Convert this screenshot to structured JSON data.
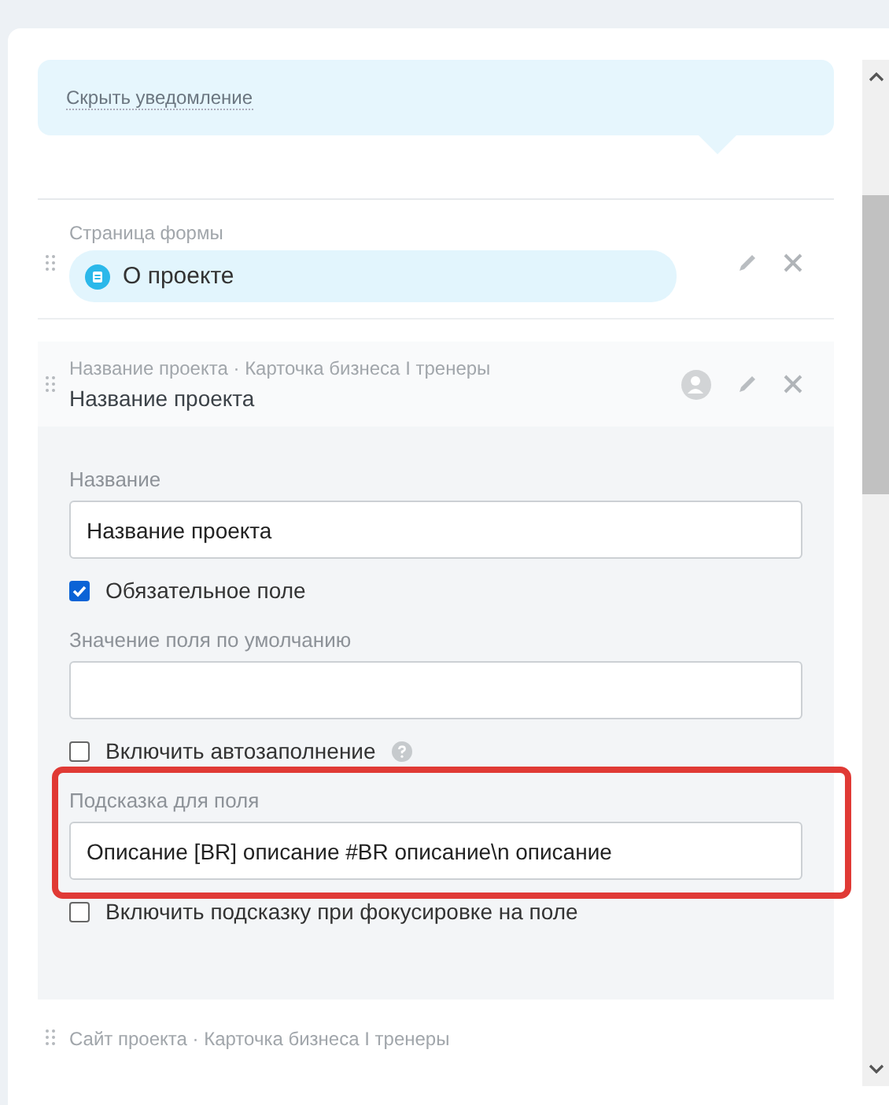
{
  "notice": {
    "link": "Скрыть уведомление"
  },
  "page_item": {
    "label": "Страница формы",
    "value": "О проекте"
  },
  "field_item": {
    "breadcrumb": "Название проекта · Карточка бизнеса I тренеры",
    "title": "Название проекта",
    "settings": [
      {
        "kind": "input",
        "label": "Название",
        "value": "Название проекта",
        "highlighted": false
      },
      {
        "kind": "checkbox",
        "label": "Обязательное поле",
        "checked": true,
        "help": false
      },
      {
        "kind": "input",
        "label": "Значение поля по умолчанию",
        "highlighted": false
      },
      {
        "kind": "checkbox",
        "label": "Включить автозаполнение",
        "checked": false,
        "help": true
      },
      {
        "kind": "input",
        "label": "Подсказка для поля",
        "value": "Описание [BR] описание #BR описание\\n описание",
        "highlighted": true
      },
      {
        "kind": "checkbox",
        "label": "Включить подсказку при фокусировке на поле",
        "checked": false,
        "help": false
      }
    ]
  },
  "next_item": {
    "breadcrumb": "Сайт проекта · Карточка бизнеса I тренеры"
  }
}
